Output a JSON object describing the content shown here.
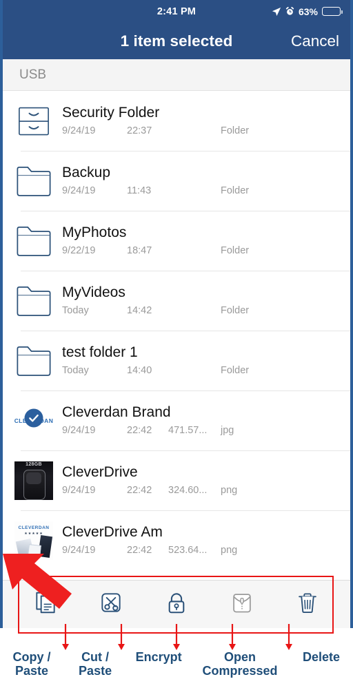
{
  "statusbar": {
    "time": "2:41 PM",
    "battery_percent": "63%",
    "location_icon": "location-arrow-icon",
    "alarm_icon": "alarm-clock-icon",
    "battery_icon": "battery-icon",
    "battery_level": 63
  },
  "navbar": {
    "title": "1 item selected",
    "cancel_label": "Cancel"
  },
  "breadcrumb": {
    "label": "USB"
  },
  "colors": {
    "nav_blue": "#2b4f84",
    "frame_blue": "#2d5f9a",
    "icon_navy": "#2b5178",
    "icon_disabled": "#9a9a9a",
    "annotation_red": "#e81515",
    "annotation_text": "#1f4e79",
    "meta_grey": "#9a9a9a"
  },
  "files": [
    {
      "name": "Security Folder",
      "date": "9/24/19",
      "time": "22:37",
      "size": "",
      "type": "Folder",
      "icon": "file-cabinet-icon",
      "selected": false
    },
    {
      "name": "Backup",
      "date": "9/24/19",
      "time": "11:43",
      "size": "",
      "type": "Folder",
      "icon": "folder-icon",
      "selected": false
    },
    {
      "name": "MyPhotos",
      "date": "9/22/19",
      "time": "18:47",
      "size": "",
      "type": "Folder",
      "icon": "folder-icon",
      "selected": false
    },
    {
      "name": "MyVideos",
      "date": "Today",
      "time": "14:42",
      "size": "",
      "type": "Folder",
      "icon": "folder-icon",
      "selected": false
    },
    {
      "name": "test folder 1",
      "date": "Today",
      "time": "14:40",
      "size": "",
      "type": "Folder",
      "icon": "folder-icon",
      "selected": false
    },
    {
      "name": "Cleverdan Brand",
      "date": "9/24/19",
      "time": "22:42",
      "size": "471.57...",
      "type": "jpg",
      "icon": "image-thumbnail-brand",
      "thumb_text": "CLEVERDAN",
      "selected": true
    },
    {
      "name": "CleverDrive",
      "date": "9/24/19",
      "time": "22:42",
      "size": "324.60...",
      "type": "png",
      "icon": "image-thumbnail-usb-drive",
      "thumb_text": "128GB",
      "selected": false
    },
    {
      "name": "CleverDrive Am",
      "date": "9/24/19",
      "time": "22:42",
      "size": "523.64...",
      "type": "png",
      "icon": "image-thumbnail-packaging",
      "thumb_text": "CLEVERDAN",
      "selected": false
    }
  ],
  "toolbar": {
    "buttons": [
      {
        "icon": "copy-icon",
        "name": "copy-paste-button",
        "enabled": true
      },
      {
        "icon": "scissors-icon",
        "name": "cut-paste-button",
        "enabled": true
      },
      {
        "icon": "lock-icon",
        "name": "encrypt-button",
        "enabled": true
      },
      {
        "icon": "zip-folder-icon",
        "name": "open-compressed-button",
        "enabled": false
      },
      {
        "icon": "trash-icon",
        "name": "delete-button",
        "enabled": true
      }
    ]
  },
  "annotations": {
    "arrow": "red-arrow-pointing-to-toolbar",
    "labels": [
      {
        "line1": "Copy /",
        "line2": "Paste"
      },
      {
        "line1": "Cut /",
        "line2": "Paste"
      },
      {
        "line1": "Encrypt",
        "line2": ""
      },
      {
        "line1": "Open",
        "line2": "Compressed"
      },
      {
        "line1": "Delete",
        "line2": ""
      }
    ]
  }
}
